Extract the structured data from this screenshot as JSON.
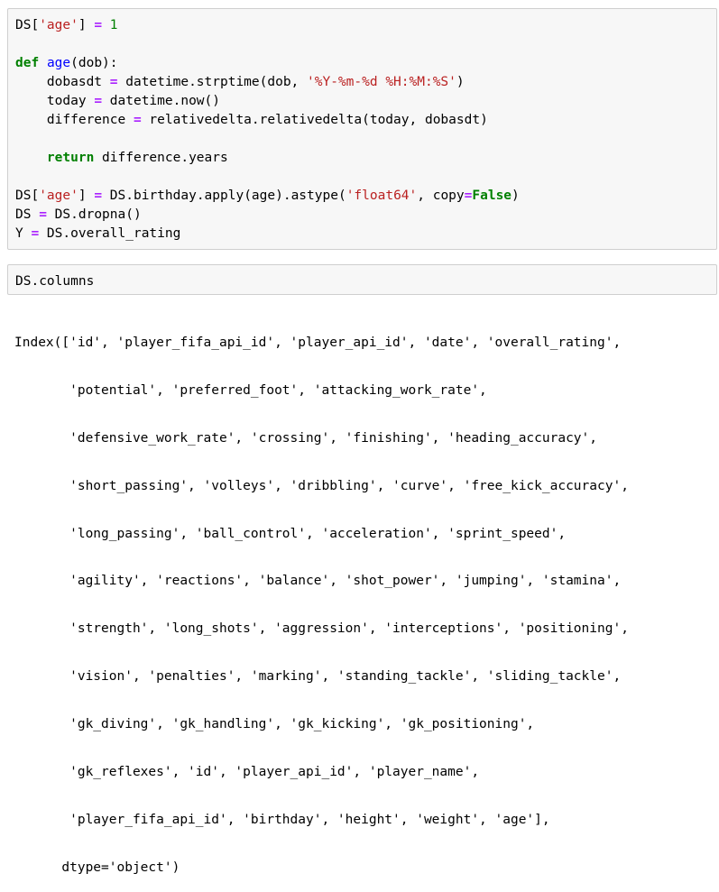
{
  "cells": [
    {
      "lines": [
        "DS['age'] = 1",
        "",
        "def age(dob):",
        "    dobasdt = datetime.strptime(dob, '%Y-%m-%d %H:%M:%S')",
        "    today = datetime.now()",
        "    difference = relativedelta.relativedelta(today, dobasdt)",
        "",
        "    return difference.years",
        "",
        "DS['age'] = DS.birthday.apply(age).astype('float64', copy=False)",
        "DS = DS.dropna()",
        "Y = DS.overall_rating"
      ]
    },
    {
      "lines": [
        "DS.columns"
      ]
    }
  ],
  "output_lines": [
    "Index(['id', 'player_fifa_api_id', 'player_api_id', 'date', 'overall_rating',",
    "       'potential', 'preferred_foot', 'attacking_work_rate',",
    "       'defensive_work_rate', 'crossing', 'finishing', 'heading_accuracy',",
    "       'short_passing', 'volleys', 'dribbling', 'curve', 'free_kick_accuracy',",
    "       'long_passing', 'ball_control', 'acceleration', 'sprint_speed',",
    "       'agility', 'reactions', 'balance', 'shot_power', 'jumping', 'stamina',",
    "       'strength', 'long_shots', 'aggression', 'interceptions', 'positioning',",
    "       'vision', 'penalties', 'marking', 'standing_tackle', 'sliding_tackle',",
    "       'gk_diving', 'gk_handling', 'gk_kicking', 'gk_positioning',",
    "       'gk_reflexes', 'id', 'player_api_id', 'player_name',",
    "       'player_fifa_api_id', 'birthday', 'height', 'weight', 'age'],",
    "      dtype='object')"
  ],
  "colors": {
    "keyword": "#008000",
    "function_name": "#0000ff",
    "string": "#ba2121",
    "operator": "#aa22ff",
    "number": "#008000",
    "cell_background": "#f7f7f7",
    "cell_border": "#cfcfcf"
  }
}
